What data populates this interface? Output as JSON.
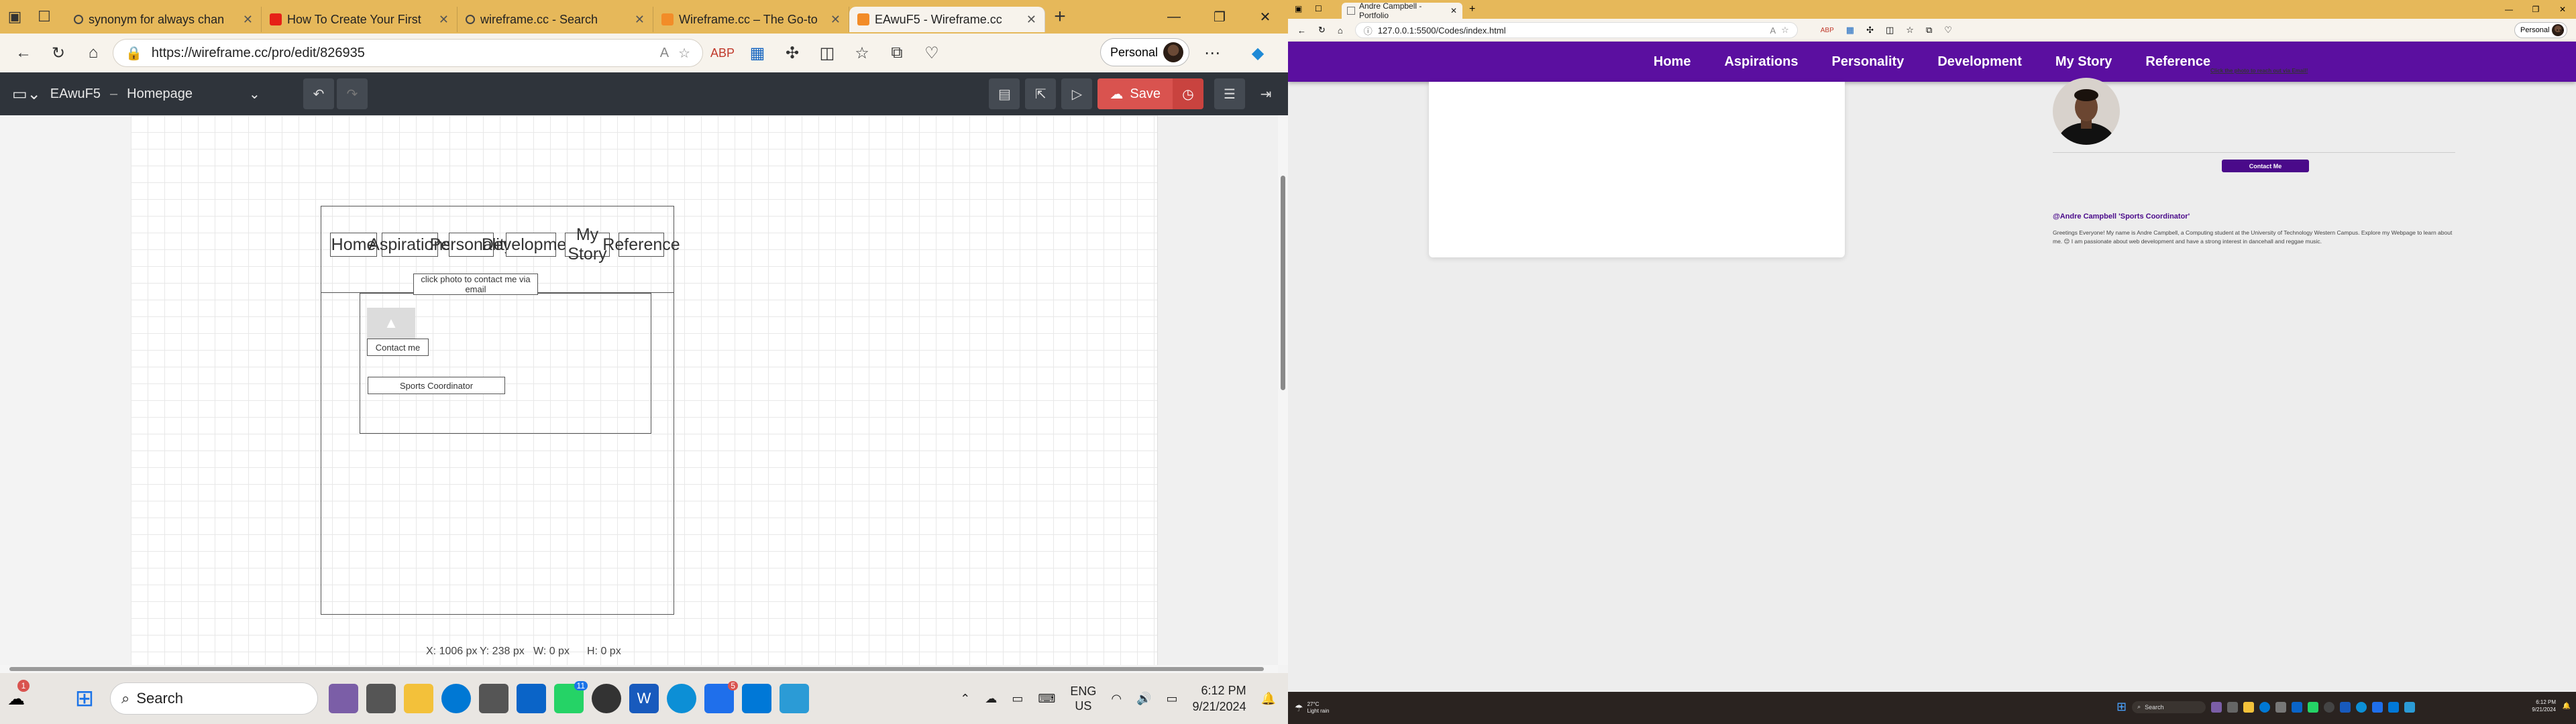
{
  "left": {
    "tabs": [
      {
        "title": "synonym for always chan",
        "color": "#e0a800"
      },
      {
        "title": "How To Create Your First",
        "color": "#e62117"
      },
      {
        "title": "wireframe.cc - Search",
        "color": "#e0a800"
      },
      {
        "title": "Wireframe.cc – The Go-to",
        "color": "#f28c28"
      },
      {
        "title": "EAwuF5 - Wireframe.cc",
        "color": "#f28c28"
      }
    ],
    "url": "https://wireframe.cc/pro/edit/826935",
    "profile_label": "Personal",
    "doc": {
      "id": "EAwuF5",
      "separator": "–",
      "page": "Homepage"
    },
    "save_label": "Save",
    "wireframe": {
      "nav": [
        "Home",
        "Aspirations",
        "Personality",
        "Development",
        "My Story",
        "Reference"
      ],
      "click_photo_text": "click photo to contact me via email",
      "contact_text": "Contact me",
      "role_text": "Sports Coordinator"
    },
    "status": {
      "x": "X: 1006 px",
      "y": "Y: 238 px",
      "w": "W: 0 px",
      "h": "H: 0 px"
    },
    "taskbar": {
      "search": "Search",
      "lang": "ENG",
      "region": "US",
      "time": "6:12 PM",
      "date": "9/21/2024",
      "notify_badge": "1",
      "whatsapp_badge": "11",
      "mail_badge": "5"
    }
  },
  "right": {
    "tab_title": "Andre Campbell - Portfolio",
    "url": "127.0.0.1:5500/Codes/index.html",
    "profile_label": "Personal",
    "nav": [
      "Home",
      "Aspirations",
      "Personality",
      "Development",
      "My Story",
      "Reference"
    ],
    "photo_hint": "Click the photo to reach out via Email!",
    "contact_button": "Contact Me",
    "handle": "@Andre Campbell 'Sports Coordinator'",
    "bio": "Greetings Everyone! My name is Andre Campbell, a Computing student at the University of Technology Western Campus. Explore my Webpage to learn about me. 😊 I am passionate about web development and have a strong interest in dancehall and reggae music.",
    "accent_color": "#5b0fa0",
    "taskbar": {
      "weather_temp": "27°C",
      "weather_desc": "Light rain",
      "search": "Search",
      "time": "6:12 PM",
      "date": "9/21/2024"
    }
  }
}
